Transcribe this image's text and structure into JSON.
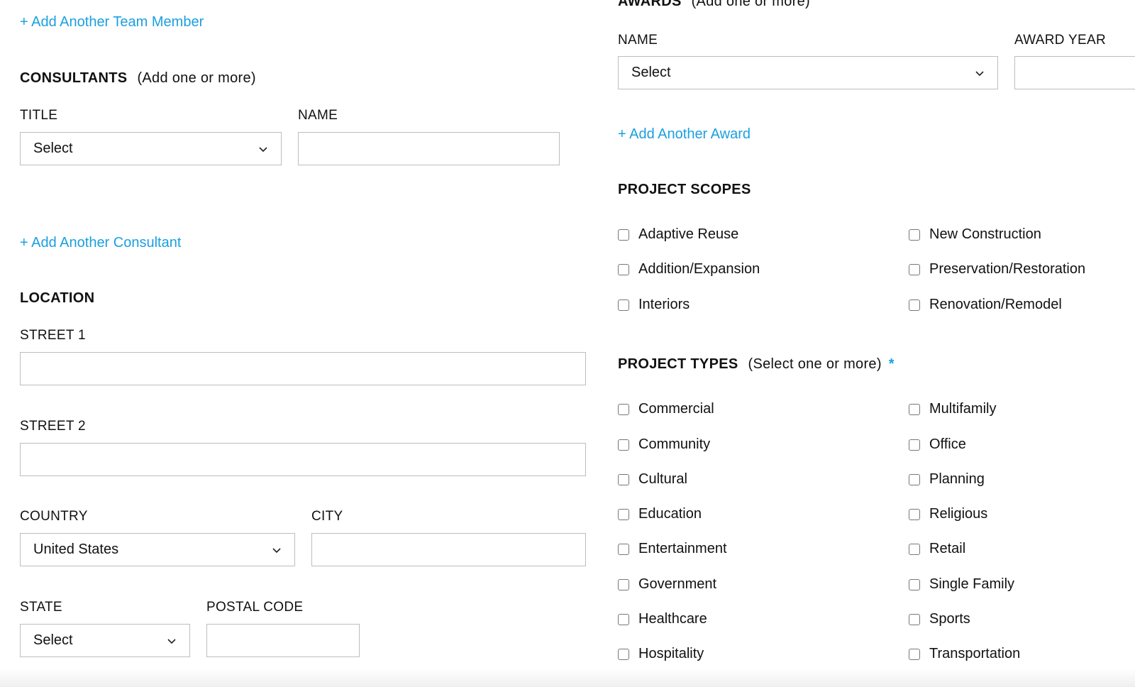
{
  "team": {
    "add_member_link": "+ Add Another Team Member"
  },
  "consultants": {
    "heading": "CONSULTANTS",
    "hint": "(Add one or more)",
    "title_label": "TITLE",
    "title_value": "Select",
    "name_label": "NAME",
    "name_value": "",
    "add_link": "+ Add Another Consultant"
  },
  "location": {
    "heading": "LOCATION",
    "street1_label": "STREET 1",
    "street1_value": "",
    "street2_label": "STREET 2",
    "street2_value": "",
    "country_label": "COUNTRY",
    "country_value": "United States",
    "city_label": "CITY",
    "city_value": "",
    "state_label": "STATE",
    "state_value": "Select",
    "postal_label": "POSTAL CODE",
    "postal_value": ""
  },
  "awards": {
    "heading": "AWARDS",
    "hint": "(Add one or more)",
    "name_label": "NAME",
    "name_value": "Select",
    "year_label": "AWARD YEAR",
    "year_value": "",
    "add_link": "+ Add Another Award"
  },
  "scopes": {
    "heading": "PROJECT SCOPES",
    "items": [
      {
        "label": "Adaptive Reuse",
        "checked": false
      },
      {
        "label": "New Construction",
        "checked": false
      },
      {
        "label": "Addition/Expansion",
        "checked": false
      },
      {
        "label": "Preservation/Restoration",
        "checked": false
      },
      {
        "label": "Interiors",
        "checked": false
      },
      {
        "label": "Renovation/Remodel",
        "checked": false
      }
    ]
  },
  "types": {
    "heading": "PROJECT TYPES",
    "hint": "(Select one or more)",
    "required_marker": "*",
    "items": [
      {
        "label": "Commercial",
        "checked": false
      },
      {
        "label": "Multifamily",
        "checked": false
      },
      {
        "label": "Community",
        "checked": false
      },
      {
        "label": "Office",
        "checked": false
      },
      {
        "label": "Cultural",
        "checked": false
      },
      {
        "label": "Planning",
        "checked": false
      },
      {
        "label": "Education",
        "checked": false
      },
      {
        "label": "Religious",
        "checked": false
      },
      {
        "label": "Entertainment",
        "checked": false
      },
      {
        "label": "Retail",
        "checked": false
      },
      {
        "label": "Government",
        "checked": false
      },
      {
        "label": "Single Family",
        "checked": false
      },
      {
        "label": "Healthcare",
        "checked": false
      },
      {
        "label": "Sports",
        "checked": false
      },
      {
        "label": "Hospitality",
        "checked": false
      },
      {
        "label": "Transportation",
        "checked": false
      }
    ]
  },
  "colors": {
    "link": "#1a9fe0",
    "border": "#bdbdbd",
    "text": "#111111"
  }
}
